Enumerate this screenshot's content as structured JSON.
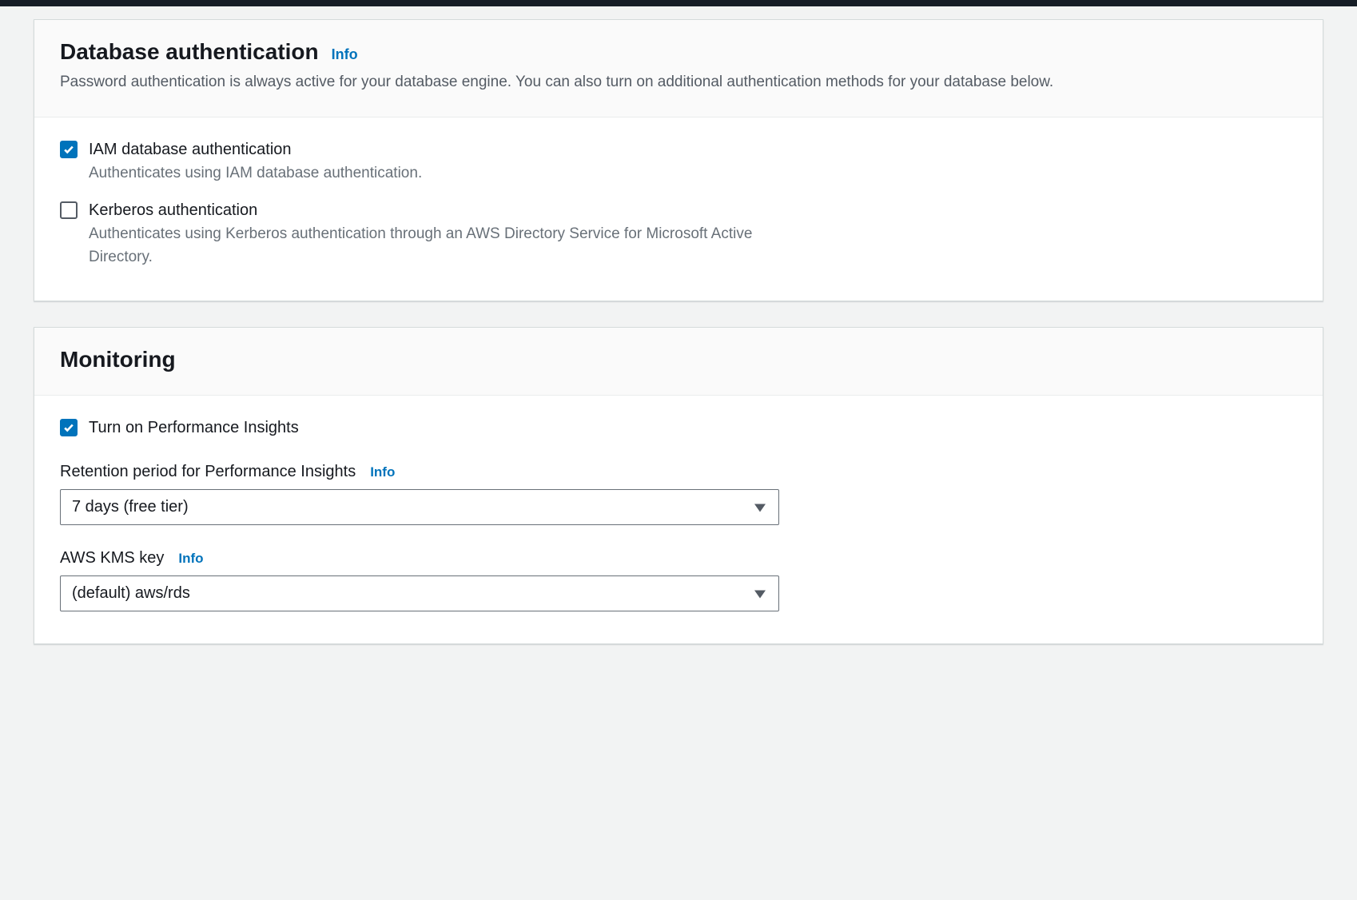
{
  "auth_panel": {
    "title": "Database authentication",
    "info": "Info",
    "description": "Password authentication is always active for your database engine. You can also turn on additional authentication methods for your database below.",
    "iam": {
      "label": "IAM database authentication",
      "desc": "Authenticates using IAM database authentication.",
      "checked": true
    },
    "kerberos": {
      "label": "Kerberos authentication",
      "desc": "Authenticates using Kerberos authentication through an AWS Directory Service for Microsoft Active Directory.",
      "checked": false
    }
  },
  "monitoring_panel": {
    "title": "Monitoring",
    "perf_insights": {
      "label": "Turn on Performance Insights",
      "checked": true
    },
    "retention": {
      "label": "Retention period for Performance Insights",
      "info": "Info",
      "value": "7 days (free tier)"
    },
    "kms": {
      "label": "AWS KMS key",
      "info": "Info",
      "value": "(default) aws/rds"
    }
  }
}
